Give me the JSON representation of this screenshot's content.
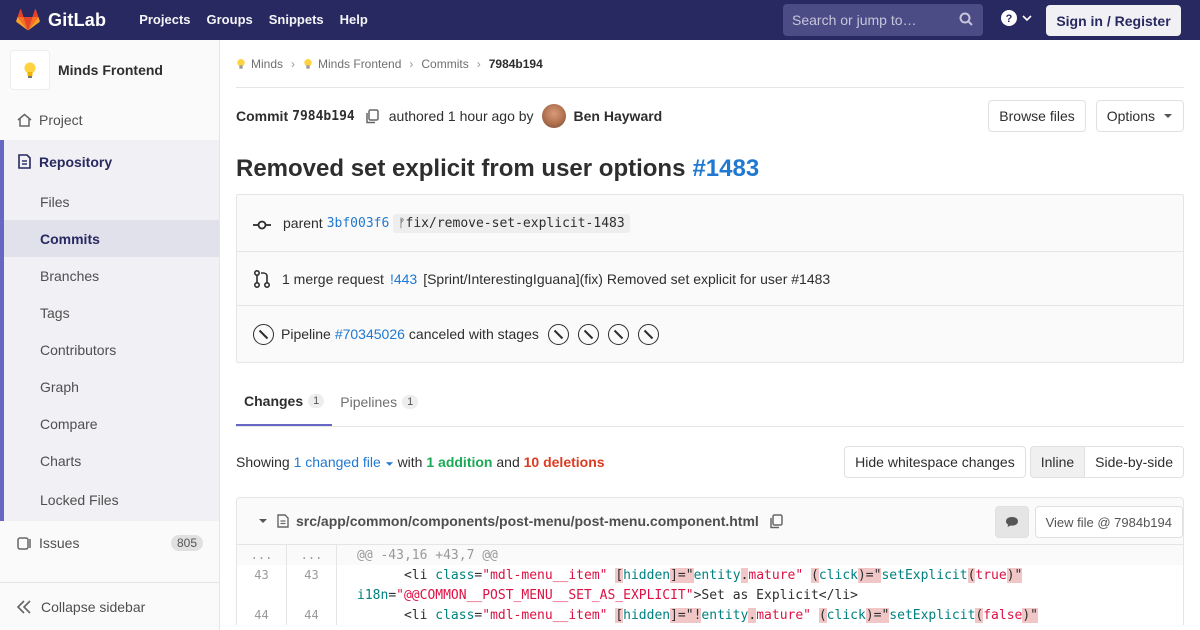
{
  "navbar": {
    "brand": "GitLab",
    "links": [
      "Projects",
      "Groups",
      "Snippets",
      "Help"
    ],
    "search_placeholder": "Search or jump to…",
    "signin_label": "Sign in / Register"
  },
  "sidebar": {
    "project_name": "Minds Frontend",
    "project_item": "Project",
    "repository": "Repository",
    "repo_items": [
      "Files",
      "Commits",
      "Branches",
      "Tags",
      "Contributors",
      "Graph",
      "Compare",
      "Charts",
      "Locked Files"
    ],
    "issues_label": "Issues",
    "issues_count": "805",
    "collapse_label": "Collapse sidebar"
  },
  "breadcrumb": {
    "items": [
      "Minds",
      "Minds Frontend",
      "Commits",
      "7984b194"
    ]
  },
  "commit": {
    "label": "Commit",
    "sha": "7984b194",
    "authored": "authored 1 hour ago by",
    "author": "Ben Hayward",
    "browse_files": "Browse files",
    "options": "Options",
    "title": "Removed set explicit from user options",
    "title_ref": "#1483",
    "parent_label": "parent",
    "parent_sha": "3bf003f6",
    "branch": "fix/remove-set-explicit-1483",
    "mr_count_label": "1 merge request",
    "mr_id": "!443",
    "mr_title": "[Sprint/InterestingIguana](fix) Removed set explicit for user #1483",
    "pipeline_label": "Pipeline",
    "pipeline_id": "#70345026",
    "pipeline_status": "canceled with stages"
  },
  "tabs": {
    "changes": "Changes",
    "changes_count": "1",
    "pipelines": "Pipelines",
    "pipelines_count": "1"
  },
  "summary": {
    "showing": "Showing",
    "changed_files": "1 changed file",
    "with": "with",
    "additions": "1 addition",
    "and": "and",
    "deletions": "10 deletions",
    "hide_whitespace": "Hide whitespace changes",
    "inline": "Inline",
    "side_by_side": "Side-by-side"
  },
  "file": {
    "path": "src/app/common/components/post-menu/post-menu.component.html",
    "view_file": "View file @ 7984b194"
  },
  "diff": {
    "hunk_old": "...",
    "hunk_new": "...",
    "hunk_header": "@@ -43,16 +43,7 @@",
    "rows": [
      {
        "old": "43",
        "new": "43"
      },
      {
        "old": "",
        "new": ""
      },
      {
        "old": "44",
        "new": "44"
      }
    ],
    "line1": {
      "t1": "      <li ",
      "a1": "class",
      "t2": "=",
      "s1": "\"mdl-menu__item\"",
      "t3": " ",
      "h1": "[",
      "a2": "hidden",
      "h2": "]=\"",
      "s2": "entity",
      "h3": ".",
      "s3": "mature\"",
      "t4": " ",
      "h4": "(",
      "a3": "click",
      "h5": ")=\"",
      "s4": "setExplicit",
      "h6": "(",
      "s5": "true",
      "h7": ")\""
    },
    "line2": {
      "a1": "i18n",
      "t1": "=",
      "s1": "\"@@COMMON__POST_MENU__SET_AS_EXPLICIT\"",
      "t2": ">Set as Explicit</li>"
    },
    "line3": {
      "t1": "      <li ",
      "a1": "class",
      "t2": "=",
      "s1": "\"mdl-menu__item\"",
      "t3": " ",
      "h1": "[",
      "a2": "hidden",
      "h2": "]=\"!",
      "s2": "entity",
      "h3": ".",
      "s3": "mature\"",
      "t4": " ",
      "h4": "(",
      "a3": "click",
      "h5": ")=\"",
      "s4": "setExplicit",
      "h6": "(",
      "s5": "false",
      "h7": ")\""
    }
  }
}
